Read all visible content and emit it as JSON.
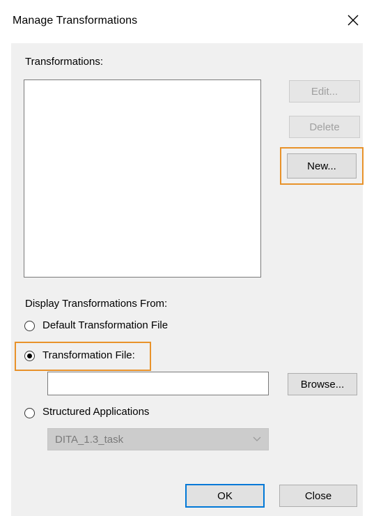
{
  "window": {
    "title": "Manage Transformations",
    "close_icon": "close-icon"
  },
  "transformations": {
    "label": "Transformations:",
    "items": []
  },
  "buttons": {
    "edit": "Edit...",
    "delete": "Delete",
    "new": "New...",
    "browse": "Browse...",
    "ok": "OK",
    "close": "Close"
  },
  "display_from": {
    "label": "Display Transformations From:",
    "options": [
      {
        "label": "Default Transformation File",
        "selected": false
      },
      {
        "label": "Transformation File:",
        "selected": true
      },
      {
        "label": "Structured Applications",
        "selected": false
      }
    ],
    "transformation_file_value": "",
    "structured_app_selected": "DITA_1.3_task"
  },
  "colors": {
    "highlight": "#e8922a",
    "dialog_bg": "#f0f0f0",
    "default_button_border": "#0078d7",
    "disabled_text": "#a0a0a0"
  }
}
